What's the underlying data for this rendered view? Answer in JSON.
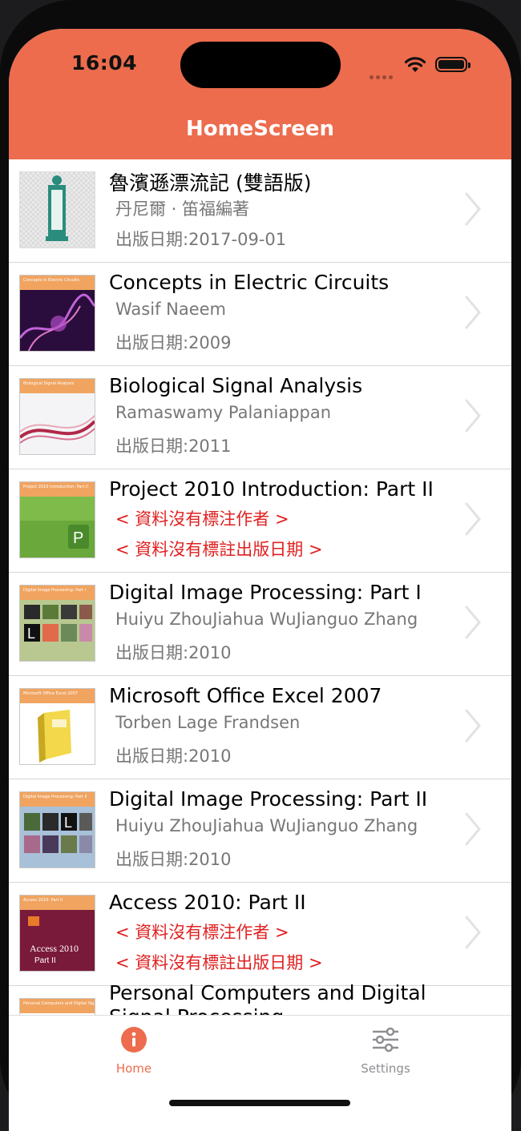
{
  "status": {
    "time": "16:04"
  },
  "header": {
    "title": "HomeScreen"
  },
  "colors": {
    "accent": "#ec6c4d",
    "missing_text": "#e02020",
    "secondary_text": "#777777"
  },
  "books": [
    {
      "title": "魯濱遜漂流記 (雙語版)",
      "author": "丹尼爾 · 笛福編著",
      "date": "出版日期:2017-09-01",
      "missing": false,
      "cover_text": ""
    },
    {
      "title": "Concepts in Electric Circuits",
      "author": "Wasif Naeem",
      "date": "出版日期:2009",
      "missing": false,
      "cover_text": "Concepts in Electric Circuits"
    },
    {
      "title": "Biological Signal Analysis",
      "author": "Ramaswamy Palaniappan",
      "date": "出版日期:2011",
      "missing": false,
      "cover_text": "Biological Signal Analysis"
    },
    {
      "title": "Project 2010 Introduction: Part II",
      "author": "< 資料沒有標注作者 >",
      "date": "< 資料沒有標註出版日期 >",
      "missing": true,
      "cover_text": "Project 2010 Introduction: Part II"
    },
    {
      "title": "Digital Image Processing: Part I",
      "author": "Huiyu ZhouJiahua WuJianguo Zhang",
      "date": "出版日期:2010",
      "missing": false,
      "cover_text": "Digital Image Processing: Part I"
    },
    {
      "title": "Microsoft Office Excel 2007",
      "author": "Torben Lage Frandsen",
      "date": "出版日期:2010",
      "missing": false,
      "cover_text": "Microsoft Office Excel 2007"
    },
    {
      "title": "Digital Image Processing: Part II",
      "author": "Huiyu ZhouJiahua WuJianguo Zhang",
      "date": "出版日期:2010",
      "missing": false,
      "cover_text": "Digital Image Processing: Part II"
    },
    {
      "title": "Access 2010: Part II",
      "author": "< 資料沒有標注作者 >",
      "date": "< 資料沒有標註出版日期 >",
      "missing": true,
      "cover_text": "Access 2010: Part II"
    },
    {
      "title": "Personal Computers and Digital Signal Processing",
      "author": "",
      "date": "",
      "missing": false,
      "cover_text": "Personal Computers and Digital Signal Processing"
    }
  ],
  "tabs": [
    {
      "label": "Home",
      "icon": "info-icon",
      "active": true
    },
    {
      "label": "Settings",
      "icon": "sliders-icon",
      "active": false
    }
  ]
}
